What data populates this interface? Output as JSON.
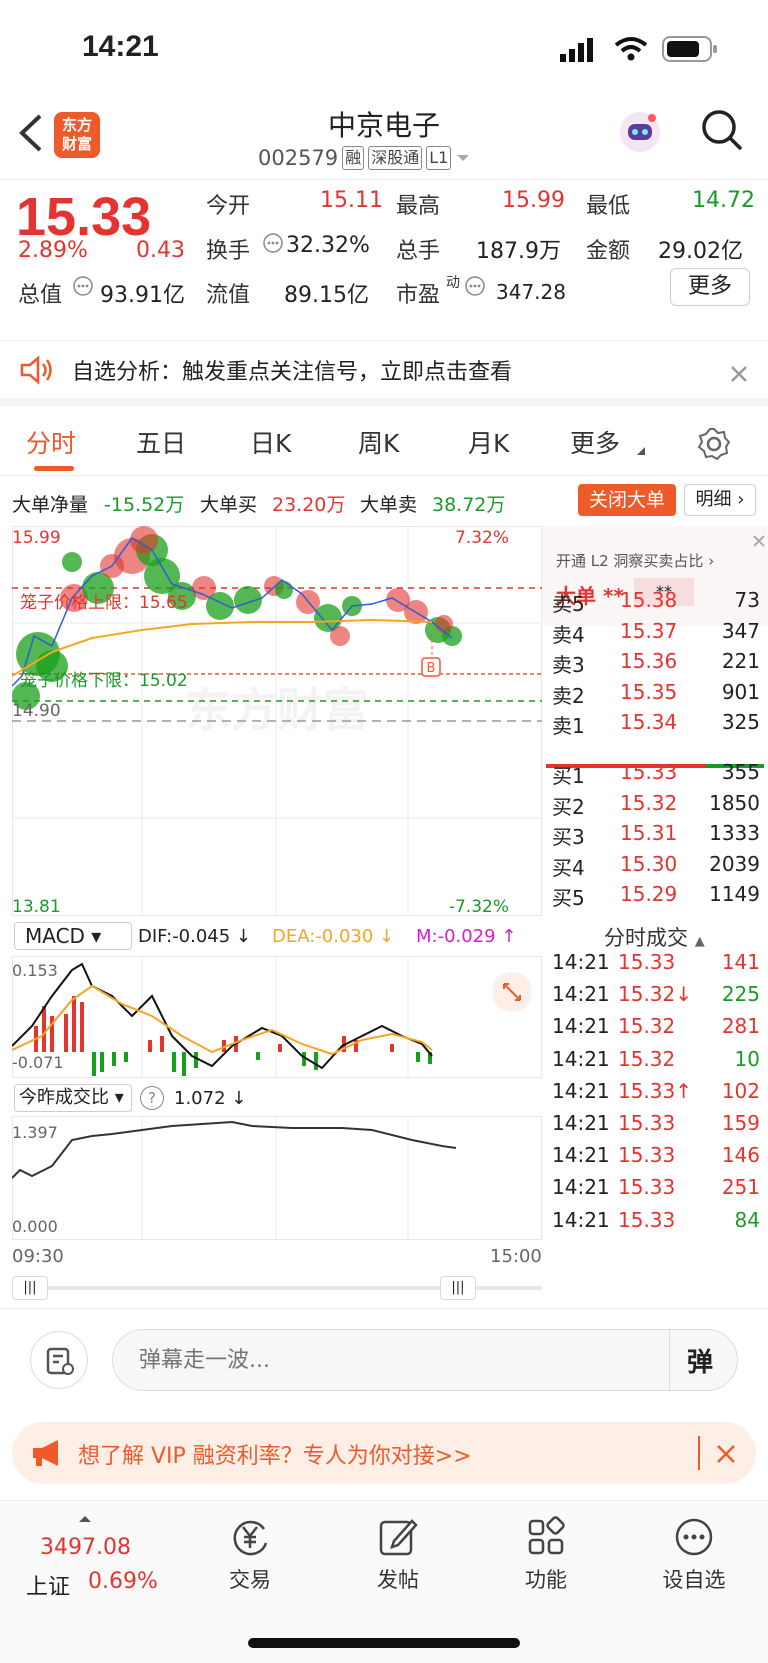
{
  "status": {
    "time": "14:21"
  },
  "header": {
    "logo_line1": "东方",
    "logo_line2": "财富",
    "stock_name": "中京电子",
    "stock_code": "002579",
    "tags": [
      "融",
      "深股通",
      "L1"
    ]
  },
  "quote": {
    "price": "15.33",
    "change_pct": "2.89%",
    "change": "0.43",
    "open_label": "今开",
    "open": "15.11",
    "high_label": "最高",
    "high": "15.99",
    "low_label": "最低",
    "low": "14.72",
    "turnover_label": "换手",
    "turnover": "32.32%",
    "volume_label": "总手",
    "volume": "187.9万",
    "amount_label": "金额",
    "amount": "29.02亿",
    "mcap_label": "总值",
    "mcap": "93.91亿",
    "float_label": "流值",
    "float": "89.15亿",
    "pe_label": "市盈",
    "pe_sup": "动",
    "pe": "347.28",
    "more_label": "更多"
  },
  "notice": {
    "text": "自选分析：触发重点关注信号，立即点击查看"
  },
  "tabs": [
    "分时",
    "五日",
    "日K",
    "周K",
    "月K",
    "更多"
  ],
  "bigorder": {
    "net_label": "大单净量",
    "net": "-15.52万",
    "buy_label": "大单买",
    "buy": "23.20万",
    "sell_label": "大单卖",
    "sell": "38.72万",
    "close_btn": "关闭大单",
    "detail_btn": "明细"
  },
  "chart": {
    "ymax": "15.99",
    "ymin": "13.81",
    "pct_max": "7.32%",
    "pct_min": "-7.32%",
    "upper_label": "笼子价格上限：15.65",
    "lower_label": "笼子价格下限：15.02",
    "prev_close": "14.90",
    "marker": "B",
    "macd_label": "MACD",
    "dif": "DIF:-0.045 ↓",
    "dea": "DEA:-0.030 ↓",
    "m": "M:-0.029 ↑",
    "macd_max": "0.153",
    "macd_min": "-0.071",
    "ratio_label": "今昨成交比",
    "ratio_help": "?",
    "ratio_value": "1.072 ↓",
    "ratio_max": "1.397",
    "ratio_min": "0.000",
    "t_start": "09:30",
    "t_end": "15:00",
    "watermark": "东方财富"
  },
  "orderbook": {
    "l2_label": "开通 L2 洞察买卖占比",
    "big_label": "大单",
    "big_mask1": "**",
    "big_mask2": "**",
    "asks": [
      {
        "label": "卖5",
        "price": "15.38",
        "vol": "73"
      },
      {
        "label": "卖4",
        "price": "15.37",
        "vol": "347"
      },
      {
        "label": "卖3",
        "price": "15.36",
        "vol": "221"
      },
      {
        "label": "卖2",
        "price": "15.35",
        "vol": "901"
      },
      {
        "label": "卖1",
        "price": "15.34",
        "vol": "325"
      }
    ],
    "bids": [
      {
        "label": "买1",
        "price": "15.33",
        "vol": "355"
      },
      {
        "label": "买2",
        "price": "15.32",
        "vol": "1850"
      },
      {
        "label": "买3",
        "price": "15.31",
        "vol": "1333"
      },
      {
        "label": "买4",
        "price": "15.30",
        "vol": "2039"
      },
      {
        "label": "买5",
        "price": "15.29",
        "vol": "1149"
      }
    ],
    "trades_label": "分时成交",
    "trades": [
      {
        "t": "14:21",
        "p": "15.33",
        "v": "141",
        "c": "red"
      },
      {
        "t": "14:21",
        "p": "15.32↓",
        "v": "225",
        "c": "green"
      },
      {
        "t": "14:21",
        "p": "15.32",
        "v": "281",
        "c": "red"
      },
      {
        "t": "14:21",
        "p": "15.32",
        "v": "10",
        "c": "green"
      },
      {
        "t": "14:21",
        "p": "15.33↑",
        "v": "102",
        "c": "red"
      },
      {
        "t": "14:21",
        "p": "15.33",
        "v": "159",
        "c": "red"
      },
      {
        "t": "14:21",
        "p": "15.33",
        "v": "146",
        "c": "red"
      },
      {
        "t": "14:21",
        "p": "15.33",
        "v": "251",
        "c": "red"
      },
      {
        "t": "14:21",
        "p": "15.33",
        "v": "84",
        "c": "green"
      }
    ]
  },
  "comment": {
    "placeholder": "弹幕走一波...",
    "danmu": "弹"
  },
  "vip": {
    "text": "想了解 VIP 融资利率？专人为你对接>>"
  },
  "nav": {
    "index_value": "3497.08",
    "index_name": "上证",
    "index_pct": "0.69%",
    "items": [
      "交易",
      "发帖",
      "功能",
      "设自选"
    ]
  }
}
